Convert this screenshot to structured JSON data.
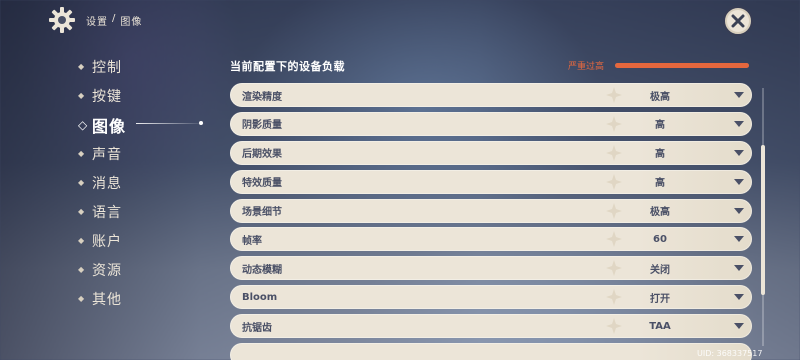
{
  "breadcrumb": {
    "parent": "设置",
    "separator": "/",
    "current": "图像"
  },
  "sidebar": {
    "items": [
      {
        "label": "控制",
        "active": false
      },
      {
        "label": "按键",
        "active": false
      },
      {
        "label": "图像",
        "active": true
      },
      {
        "label": "声音",
        "active": false
      },
      {
        "label": "消息",
        "active": false
      },
      {
        "label": "语言",
        "active": false
      },
      {
        "label": "账户",
        "active": false
      },
      {
        "label": "资源",
        "active": false
      },
      {
        "label": "其他",
        "active": false
      }
    ]
  },
  "device_load": {
    "title": "当前配置下的设备负载",
    "status": "严重过高",
    "level_percent": 100,
    "color": "#e5673d"
  },
  "settings": [
    {
      "label": "渲染精度",
      "value": "极高"
    },
    {
      "label": "阴影质量",
      "value": "高"
    },
    {
      "label": "后期效果",
      "value": "高"
    },
    {
      "label": "特效质量",
      "value": "高"
    },
    {
      "label": "场景细节",
      "value": "极高"
    },
    {
      "label": "帧率",
      "value": "60"
    },
    {
      "label": "动态模糊",
      "value": "关闭"
    },
    {
      "label": "Bloom",
      "value": "打开"
    },
    {
      "label": "抗锯齿",
      "value": "TAA"
    },
    {
      "label": "",
      "value": ""
    }
  ],
  "uid": "UID: 368337517",
  "icons": {
    "settings": "gear-icon",
    "close": "close-icon",
    "dropdown": "triangle-down-icon",
    "nav_marker": "diamond-icon"
  }
}
